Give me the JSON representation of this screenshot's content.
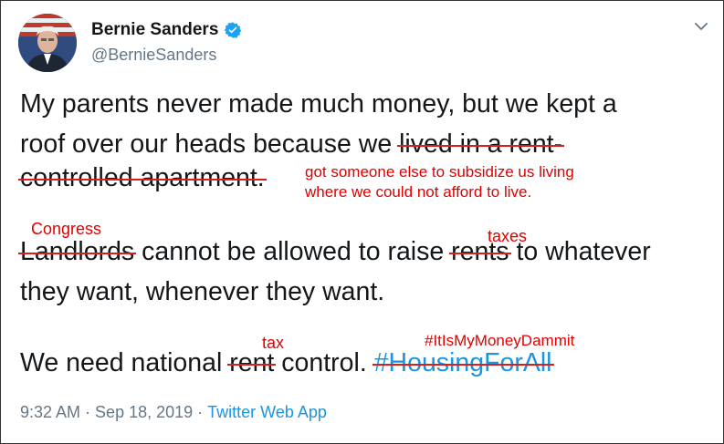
{
  "author": {
    "display_name": "Bernie Sanders",
    "handle": "@BernieSanders",
    "verified": true
  },
  "tweet": {
    "line1": "My parents never made much money, but we kept a",
    "line2_pre": "roof over our heads because we ",
    "line2_struck": "lived in a rent-",
    "line3_struck": "controlled apartment.",
    "line4_struck_a": "Landlords",
    "line4_mid": " cannot be allowed to raise ",
    "line4_struck_b": "rents",
    "line4_post": " to whatever",
    "line5": "they want, whenever they want.",
    "line6_pre": "We need national ",
    "line6_struck": "rent",
    "line6_mid": " control. ",
    "line6_hashtag": "#HousingForAll"
  },
  "annotations": {
    "subsidize_line1": "got someone else to subsidize us living",
    "subsidize_line2": "where we could not afford to live.",
    "congress": "Congress",
    "taxes": "taxes",
    "tax": "tax",
    "money_hashtag": "#ItIsMyMoneyDammit",
    "color": "#e00000"
  },
  "meta": {
    "time": "9:32 AM",
    "separator": "·",
    "date": "Sep 18, 2019",
    "source": "Twitter Web App"
  },
  "icons": [
    "avatar",
    "verified-badge-icon",
    "chevron-down-icon"
  ],
  "colors": {
    "link_blue": "#1b95e0",
    "muted_gray": "#657786",
    "text_dark": "#14171a",
    "strike_red": "#d62020"
  }
}
